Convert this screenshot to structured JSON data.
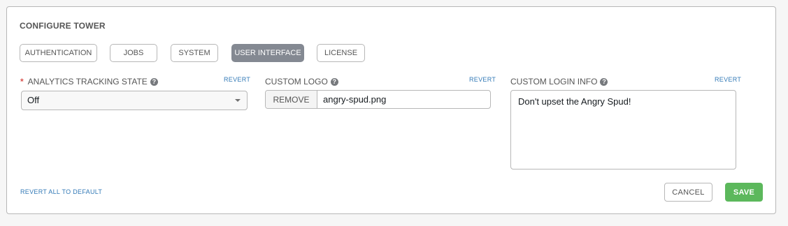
{
  "page": {
    "title": "CONFIGURE TOWER"
  },
  "tabs": [
    {
      "label": "AUTHENTICATION",
      "active": false
    },
    {
      "label": "JOBS",
      "active": false
    },
    {
      "label": "SYSTEM",
      "active": false
    },
    {
      "label": "USER INTERFACE",
      "active": true
    },
    {
      "label": "LICENSE",
      "active": false
    }
  ],
  "fields": {
    "analytics": {
      "required_marker": "*",
      "label": "ANALYTICS TRACKING STATE",
      "revert": "REVERT",
      "value": "Off",
      "help_icon": "question-circle-icon"
    },
    "logo": {
      "label": "CUSTOM LOGO",
      "revert": "REVERT",
      "remove_label": "REMOVE",
      "file_name": "angry-spud.png",
      "help_icon": "question-circle-icon"
    },
    "login_info": {
      "label": "CUSTOM LOGIN INFO",
      "revert": "REVERT",
      "value": "Don't upset the Angry Spud!",
      "help_icon": "question-circle-icon"
    }
  },
  "footer": {
    "revert_all": "REVERT ALL TO DEFAULT",
    "cancel": "CANCEL",
    "save": "SAVE"
  },
  "colors": {
    "active_tab": "#848992",
    "save": "#5cb85c",
    "link": "#337ab7",
    "required": "#d9534f"
  }
}
